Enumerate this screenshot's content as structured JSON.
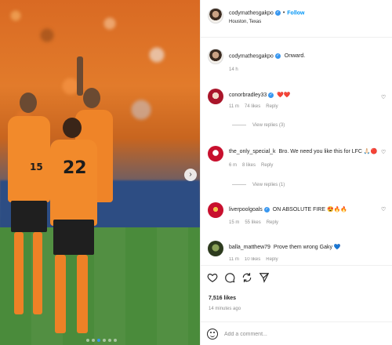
{
  "post": {
    "author": "codymathesgakpo",
    "follow_label": "Follow",
    "location": "Houston, Texas",
    "caption_author": "codymathesgakpo",
    "caption": "Onward.",
    "caption_time": "14 h",
    "carousel_dots": 6,
    "carousel_active_index": 2
  },
  "player_numbers": [
    "15",
    "22"
  ],
  "comments": [
    {
      "user": "conorbradley33",
      "verified": true,
      "text": "❤️❤️",
      "time": "11 m",
      "likes": "74 likes",
      "reply": "Reply",
      "view_replies": "View replies (3)"
    },
    {
      "user": "the_only_special_k",
      "verified": false,
      "text": "Bro. We need you like this for LFC 🙏🏻🔴",
      "time": "6 m",
      "likes": "8 likes",
      "reply": "Reply",
      "view_replies": "View replies (1)"
    },
    {
      "user": "liverpoolgoals",
      "verified": true,
      "text": "ON ABSOLUTE FIRE 😍🔥🔥",
      "time": "15 m",
      "likes": "55 likes",
      "reply": "Reply",
      "view_replies": ""
    },
    {
      "user": "balla_matthew79",
      "verified": false,
      "text": "Prove them wrong Gaky 💙",
      "time": "11 m",
      "likes": "10 likes",
      "reply": "Reply",
      "view_replies": ""
    }
  ],
  "footer": {
    "likes": "7,516 likes",
    "time": "14 minutes ago",
    "comment_placeholder": "Add a comment..."
  },
  "icons": [
    "heart-icon",
    "comment-icon",
    "share-icon",
    "send-icon",
    "emoji-icon",
    "chevron-right-icon",
    "verified-icon"
  ],
  "colors": {
    "accent": "#0095f6",
    "verified": "#3897f0",
    "like": "#ed4956"
  }
}
